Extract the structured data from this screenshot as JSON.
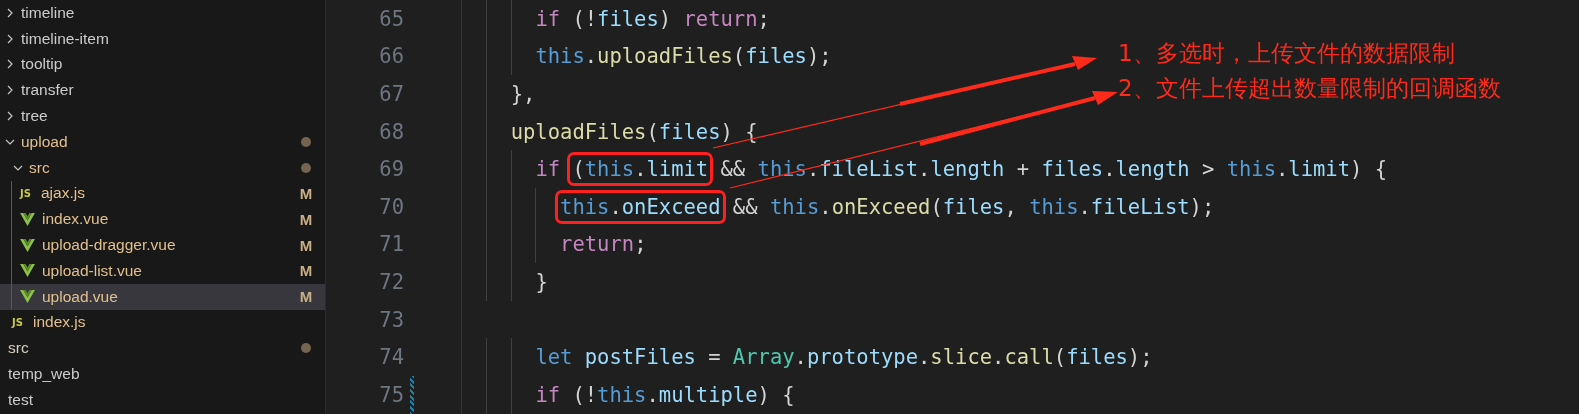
{
  "explorer": {
    "items": [
      {
        "label": "timeline",
        "kind": "folder",
        "expanded": false,
        "modified": false
      },
      {
        "label": "timeline-item",
        "kind": "folder",
        "expanded": false,
        "modified": false
      },
      {
        "label": "tooltip",
        "kind": "folder",
        "expanded": false,
        "modified": false
      },
      {
        "label": "transfer",
        "kind": "folder",
        "expanded": false,
        "modified": false
      },
      {
        "label": "tree",
        "kind": "folder",
        "expanded": false,
        "modified": false
      },
      {
        "label": "upload",
        "kind": "folder",
        "expanded": true,
        "modified": true,
        "children": [
          {
            "label": "src",
            "kind": "folder",
            "expanded": true,
            "modified": true,
            "children": [
              {
                "label": "ajax.js",
                "kind": "js",
                "icon_text": "JS",
                "git": "M",
                "selected": false
              },
              {
                "label": "index.vue",
                "kind": "vue",
                "git": "M",
                "selected": false
              },
              {
                "label": "upload-dragger.vue",
                "kind": "vue",
                "git": "M",
                "selected": false
              },
              {
                "label": "upload-list.vue",
                "kind": "vue",
                "git": "M",
                "selected": false
              },
              {
                "label": "upload.vue",
                "kind": "vue",
                "git": "M",
                "selected": true
              }
            ]
          },
          {
            "label": "index.js",
            "kind": "js",
            "icon_text": "JS",
            "selected": false
          }
        ]
      }
    ],
    "outer": [
      {
        "label": "src",
        "modified": true
      },
      {
        "label": "temp_web",
        "modified": false
      },
      {
        "label": "test",
        "modified": false
      }
    ]
  },
  "editor": {
    "lines": [
      {
        "children": [
          {
            "number": "65",
            "tokens": [
              {
                "kind": "kw",
                "text": "if"
              },
              {
                "kind": "op",
                "text": " (!"
              },
              {
                "kind": "var",
                "text": "files"
              },
              {
                "kind": "op",
                "text": ") "
              },
              {
                "kind": "kw",
                "text": "return"
              },
              {
                "kind": "op",
                "text": ";"
              }
            ]
          },
          {
            "number": "66",
            "tokens": [
              {
                "kind": "this",
                "text": "this"
              },
              {
                "kind": "op",
                "text": "."
              },
              {
                "kind": "fn",
                "text": "uploadFiles"
              },
              {
                "kind": "op",
                "text": "("
              },
              {
                "kind": "var",
                "text": "files"
              },
              {
                "kind": "op",
                "text": ");"
              }
            ]
          }
        ]
      },
      {
        "number": "67",
        "tokens": [
          {
            "kind": "op",
            "text": "},"
          }
        ]
      },
      {
        "number": "68",
        "tokens": [
          {
            "kind": "fn",
            "text": "uploadFiles"
          },
          {
            "kind": "op",
            "text": "("
          },
          {
            "kind": "var",
            "text": "files"
          },
          {
            "kind": "op",
            "text": ") {"
          }
        ],
        "children": [
          {
            "number": "69",
            "tokens": [
              {
                "kind": "kw",
                "text": "if "
              },
              {
                "kind": "op",
                "text": "(",
                "boxed": true
              },
              {
                "kind": "this",
                "text": "this",
                "boxed": true
              },
              {
                "kind": "op",
                "text": ".",
                "boxed": true
              },
              {
                "kind": "var",
                "text": "limit",
                "boxed": true
              },
              {
                "kind": "op",
                "text": " &&"
              },
              {
                "kind": "this",
                "text": " this"
              },
              {
                "kind": "op",
                "text": "."
              },
              {
                "kind": "var",
                "text": "fileList"
              },
              {
                "kind": "op",
                "text": "."
              },
              {
                "kind": "var",
                "text": "length"
              },
              {
                "kind": "op",
                "text": " + "
              },
              {
                "kind": "var",
                "text": "files"
              },
              {
                "kind": "op",
                "text": "."
              },
              {
                "kind": "var",
                "text": "length"
              },
              {
                "kind": "op",
                "text": " > "
              },
              {
                "kind": "this",
                "text": "this"
              },
              {
                "kind": "op",
                "text": "."
              },
              {
                "kind": "var",
                "text": "limit"
              },
              {
                "kind": "op",
                "text": ") {"
              }
            ],
            "children": [
              {
                "number": "70",
                "tokens": [
                  {
                    "kind": "this",
                    "text": "this",
                    "boxed": true
                  },
                  {
                    "kind": "op",
                    "text": ".",
                    "boxed": true
                  },
                  {
                    "kind": "var",
                    "text": "onExceed",
                    "boxed": true
                  },
                  {
                    "kind": "op",
                    "text": " &&"
                  },
                  {
                    "kind": "this",
                    "text": " this"
                  },
                  {
                    "kind": "op",
                    "text": "."
                  },
                  {
                    "kind": "fn",
                    "text": "onExceed"
                  },
                  {
                    "kind": "op",
                    "text": "("
                  },
                  {
                    "kind": "var",
                    "text": "files"
                  },
                  {
                    "kind": "op",
                    "text": ", "
                  },
                  {
                    "kind": "this",
                    "text": "this"
                  },
                  {
                    "kind": "op",
                    "text": "."
                  },
                  {
                    "kind": "var",
                    "text": "fileList"
                  },
                  {
                    "kind": "op",
                    "text": ");"
                  }
                ]
              },
              {
                "number": "71",
                "tokens": [
                  {
                    "kind": "kw",
                    "text": "return"
                  },
                  {
                    "kind": "op",
                    "text": ";"
                  }
                ]
              }
            ]
          },
          {
            "number": "72",
            "tokens": [
              {
                "kind": "op",
                "text": "}"
              }
            ]
          },
          {
            "number": "73"
          },
          {
            "number": "74",
            "tokens": [
              {
                "kind": "this",
                "text": "let"
              },
              {
                "kind": "var",
                "text": " postFiles"
              },
              {
                "kind": "op",
                "text": " = "
              },
              {
                "kind": "cls",
                "text": "Array"
              },
              {
                "kind": "op",
                "text": "."
              },
              {
                "kind": "var",
                "text": "prototype"
              },
              {
                "kind": "op",
                "text": "."
              },
              {
                "kind": "fn",
                "text": "slice"
              },
              {
                "kind": "op",
                "text": "."
              },
              {
                "kind": "fn",
                "text": "call"
              },
              {
                "kind": "op",
                "text": "("
              },
              {
                "kind": "var",
                "text": "files"
              },
              {
                "kind": "op",
                "text": ");"
              }
            ]
          },
          {
            "number": "75",
            "changed": true,
            "tokens": [
              {
                "kind": "kw",
                "text": "if"
              },
              {
                "kind": "op",
                "text": " (!"
              },
              {
                "kind": "this",
                "text": "this"
              },
              {
                "kind": "op",
                "text": "."
              },
              {
                "kind": "var",
                "text": "multiple"
              },
              {
                "kind": "op",
                "text": ") {"
              }
            ]
          }
        ]
      }
    ]
  },
  "annotations": [
    {
      "text": "1、多选时，上传文件的数据限制"
    },
    {
      "text": "2、文件上传超出数量限制的回调函数"
    }
  ]
}
